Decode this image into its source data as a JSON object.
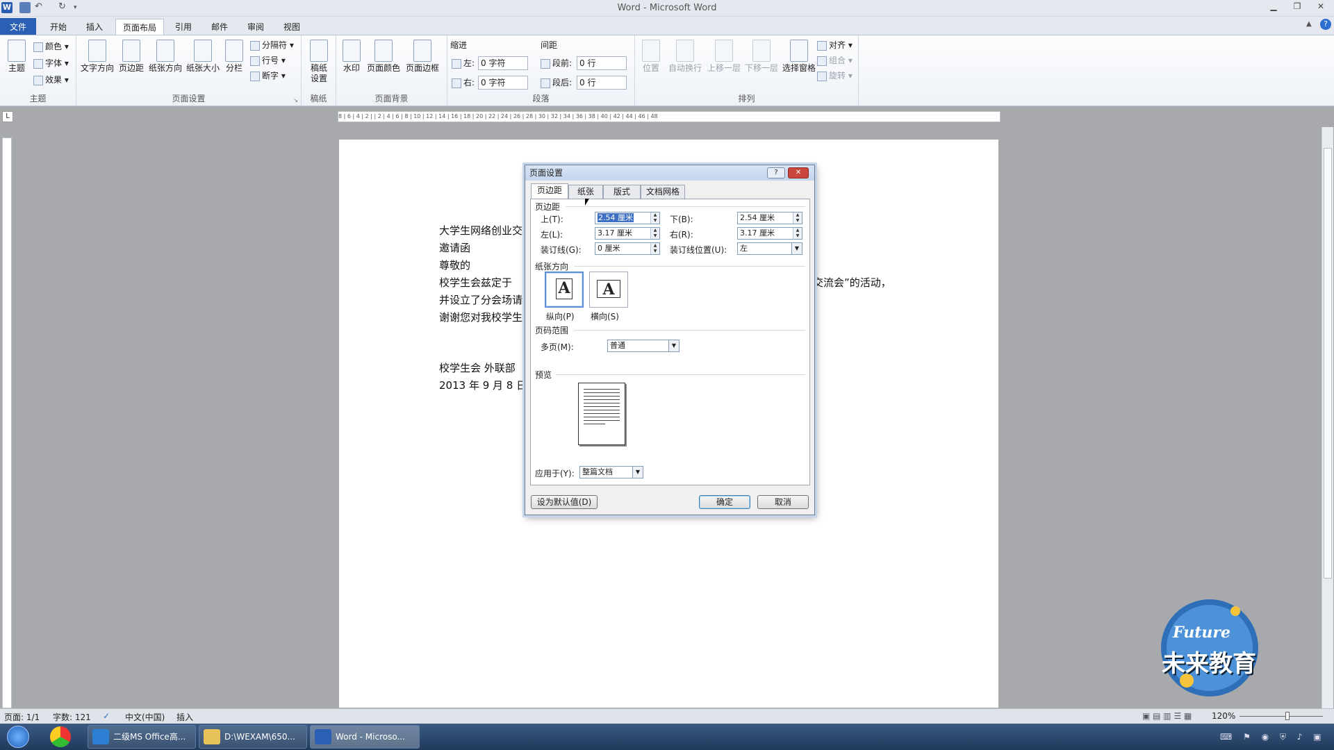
{
  "window": {
    "title": "Word - Microsoft Word"
  },
  "tabs": [
    "文件",
    "开始",
    "插入",
    "页面布局",
    "引用",
    "邮件",
    "审阅",
    "视图"
  ],
  "ribbon": {
    "theme_group": {
      "label": "主题",
      "theme_btn": "主题",
      "colors": "颜色",
      "fonts": "字体",
      "effects": "效果"
    },
    "page_setup_group": {
      "label": "页面设置",
      "text_direction": "文字方向",
      "margins": "页边距",
      "orientation": "纸张方向",
      "size": "纸张大小",
      "columns": "分栏",
      "breaks": "分隔符",
      "line_numbers": "行号",
      "hyphenation": "断字"
    },
    "draft_group": {
      "label": "稿纸",
      "draft_settings": "稿纸\n设置"
    },
    "background_group": {
      "label": "页面背景",
      "watermark": "水印",
      "page_color": "页面颜色",
      "page_borders": "页面边框"
    },
    "paragraph_group": {
      "label": "段落",
      "indent": "缩进",
      "spacing": "间距",
      "left_label": "左:",
      "left_val": "0 字符",
      "right_label": "右:",
      "right_val": "0 字符",
      "before_label": "段前:",
      "before_val": "0 行",
      "after_label": "段后:",
      "after_val": "0 行"
    },
    "arrange_group": {
      "label": "排列",
      "position": "位置",
      "wrap": "自动换行",
      "forward": "上移一层",
      "backward": "下移一层",
      "selection_pane": "选择窗格",
      "align": "对齐",
      "group": "组合",
      "rotate": "旋转"
    }
  },
  "ruler": {
    "text": "8 | 6 | 4 | 2 | | 2 | 4 | 6 | 8 | 10 | 12 | 14 | 16 | 18 | 20 | 22 | 24 | 26 | 28 | 30 | 32 | 34 | 36 | 38 | 40 | 42 | 44 | 46 | 48"
  },
  "document": {
    "lines": [
      "大学生网络创业交",
      "邀请函",
      "尊敬的",
      "校学生会兹定于",
      "并设立了分会场请",
      "谢谢您对我校学生"
    ],
    "right_fragment": "交流会”的活动，",
    "signature": "校学生会 外联部",
    "date": "2013 年 9 月 8 日"
  },
  "dialog": {
    "title": "页面设置",
    "help": "?",
    "close": "✕",
    "tabs": [
      "页边距",
      "纸张",
      "版式",
      "文档网格"
    ],
    "margins_section": "页边距",
    "top_label": "上(T):",
    "top_val": "2.54 厘米",
    "bottom_label": "下(B):",
    "bottom_val": "2.54 厘米",
    "left_label": "左(L):",
    "left_val": "3.17 厘米",
    "right_label": "右(R):",
    "right_val": "3.17 厘米",
    "gutter_label": "装订线(G):",
    "gutter_val": "0 厘米",
    "gutter_pos_label": "装订线位置(U):",
    "gutter_pos_val": "左",
    "orientation_section": "纸张方向",
    "portrait": "纵向(P)",
    "landscape": "横向(S)",
    "pages_section": "页码范围",
    "multiple_label": "多页(M):",
    "multiple_val": "普通",
    "preview_section": "预览",
    "apply_label": "应用于(Y):",
    "apply_val": "整篇文档",
    "default_btn": "设为默认值(D)",
    "ok": "确定",
    "cancel": "取消"
  },
  "status": {
    "page": "页面: 1/1",
    "words": "字数: 121",
    "lang": "中文(中国)",
    "mode": "插入",
    "zoom": "120%"
  },
  "taskbar": {
    "items": [
      "二级MS Office高...",
      "D:\\WEXAM\\650...",
      "Word - Microso..."
    ]
  },
  "logo": {
    "line1": "Future",
    "line2": "未来教育"
  },
  "colors": {
    "file_tab": "#2b5fb3",
    "selection": "#3d6fc2",
    "taskbar": "#203a5b"
  }
}
